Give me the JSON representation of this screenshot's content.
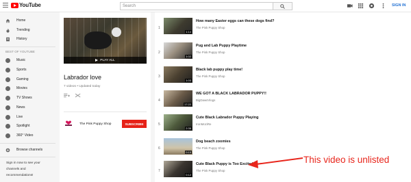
{
  "header": {
    "logo_text": "YouTube",
    "search_placeholder": "Search",
    "signin_label": "SIGN IN"
  },
  "sidebar": {
    "primary": [
      {
        "label": "Home",
        "icon": "home-icon"
      },
      {
        "label": "Trending",
        "icon": "trending-icon"
      },
      {
        "label": "History",
        "icon": "history-icon"
      }
    ],
    "best_title": "BEST OF YOUTUBE",
    "best": [
      {
        "label": "Music"
      },
      {
        "label": "Sports"
      },
      {
        "label": "Gaming"
      },
      {
        "label": "Movies"
      },
      {
        "label": "TV Shows"
      },
      {
        "label": "News"
      },
      {
        "label": "Live"
      },
      {
        "label": "Spotlight"
      },
      {
        "label": "360° Video"
      }
    ],
    "browse_label": "Browse channels",
    "signin_note": "Sign in now to see your channels and recommendations!"
  },
  "playlist": {
    "play_all": "PLAY ALL",
    "title": "Labrador love",
    "meta": "7 videos • Updated today",
    "owner": "The Pink Puppy Shop",
    "subscribe": "SUBSCRIBE"
  },
  "videos": [
    {
      "index": "1",
      "title": "How many Easter eggs can these dogs find?",
      "channel": "The Pink Puppy Shop",
      "duration": "1:14"
    },
    {
      "index": "2",
      "title": "Pug and Lab Puppy Playtime",
      "channel": "The Pink Puppy Shop",
      "duration": "1:02"
    },
    {
      "index": "3",
      "title": "Black lab puppy play time!",
      "channel": "The Pink Puppy Shop",
      "duration": "1:03"
    },
    {
      "index": "4",
      "title": "WE GOT A BLACK LABRADOR PUPPY!!",
      "channel": "BigDawsVlogs",
      "duration": "17:22"
    },
    {
      "index": "5",
      "title": "Cute Black Labrador Puppy Playing",
      "channel": "IronMoziRe",
      "duration": "2:35"
    },
    {
      "index": "6",
      "title": "Dog beach zoomies",
      "channel": "The Pink Puppy Shop",
      "duration": "0:15"
    },
    {
      "index": "7",
      "title": "Cute Black Puppy is Too Excited",
      "channel": "The Pink Puppy Shop",
      "duration": "0:12"
    }
  ],
  "annotation": "This video is unlisted",
  "colors": {
    "accent": "#ff0000",
    "subscribe": "#e62117",
    "annotation": "#e8261c",
    "signin": "#2372d4"
  }
}
